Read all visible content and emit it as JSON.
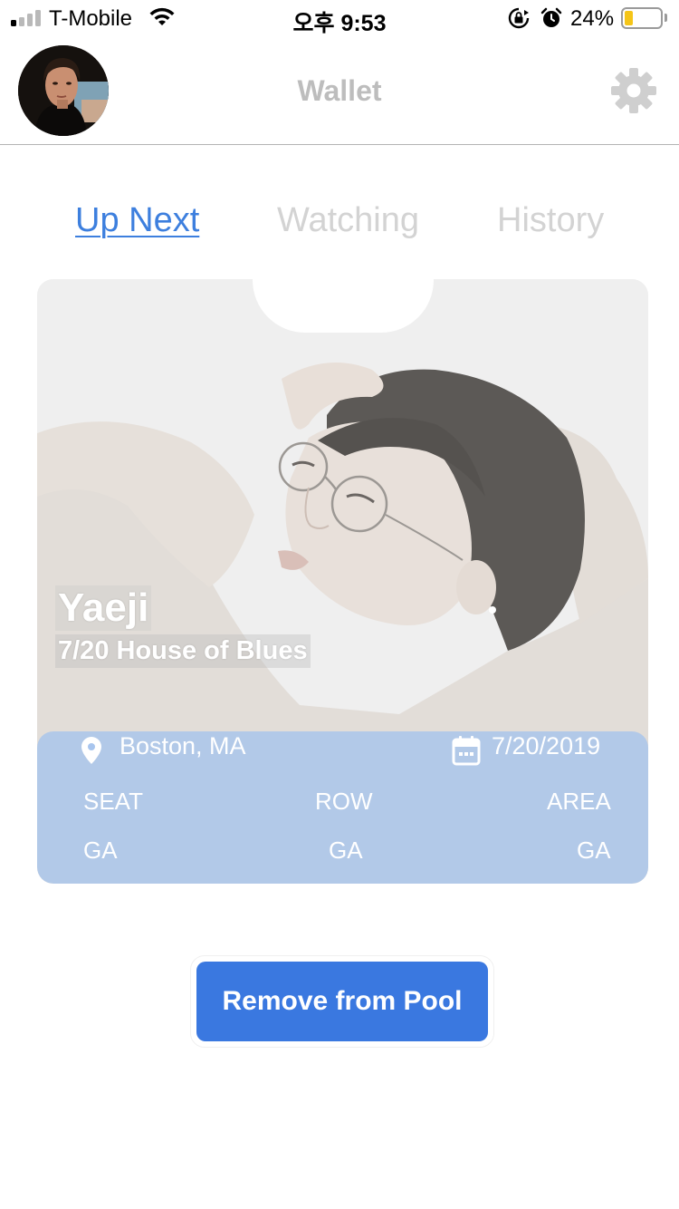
{
  "status_bar": {
    "carrier": "T-Mobile",
    "time": "오후 9:53",
    "battery_percent_label": "24%",
    "battery_level": 0.24,
    "signal_bars_active": 1,
    "signal_bars_total": 4,
    "icons": [
      "signal-icon",
      "wifi-icon",
      "rotation-lock-icon",
      "alarm-icon",
      "battery-icon"
    ]
  },
  "header": {
    "title": "Wallet",
    "avatar_icon": "user-avatar",
    "settings_icon": "gear-icon"
  },
  "tabs": [
    {
      "label": "Up Next",
      "active": true
    },
    {
      "label": "Watching",
      "active": false
    },
    {
      "label": "History",
      "active": false
    }
  ],
  "ticket": {
    "artist": "Yaeji",
    "subtitle": "7/20 House of Blues",
    "location": "Boston, MA",
    "date": "7/20/2019",
    "location_icon": "location-pin-icon",
    "date_icon": "calendar-icon",
    "fields": [
      {
        "label": "SEAT",
        "value": "GA"
      },
      {
        "label": "ROW",
        "value": "GA"
      },
      {
        "label": "AREA",
        "value": "GA"
      }
    ]
  },
  "actions": {
    "remove_label": "Remove from Pool"
  },
  "colors": {
    "accent": "#3a78e0",
    "tab_active": "#3d7fde",
    "tab_inactive": "#d3d3d3",
    "info_panel": "#a0c0ee",
    "battery": "#f5c518"
  }
}
